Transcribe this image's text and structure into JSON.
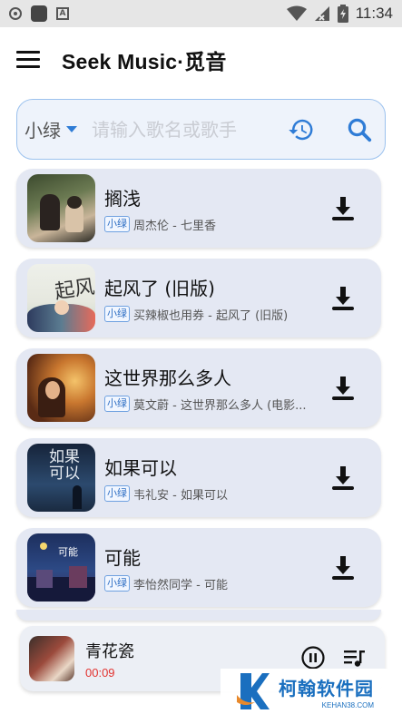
{
  "status_bar": {
    "time": "11:34"
  },
  "header": {
    "title": "Seek Music·觅音",
    "menu_icon": "menu-icon"
  },
  "search": {
    "source": "小绿",
    "placeholder": "请输入歌名或歌手",
    "history_icon": "history-icon",
    "search_icon": "search-icon"
  },
  "songs": [
    {
      "title": "搁浅",
      "source": "小绿",
      "subtitle": "周杰伦 - 七里香"
    },
    {
      "title": "起风了 (旧版)",
      "source": "小绿",
      "subtitle": "买辣椒也用券 - 起风了 (旧版)"
    },
    {
      "title": "这世界那么多人",
      "source": "小绿",
      "subtitle": "莫文蔚 - 这世界那么多人 (电影..."
    },
    {
      "title": "如果可以",
      "source": "小绿",
      "subtitle": "韦礼安 - 如果可以"
    },
    {
      "title": "可能",
      "source": "小绿",
      "subtitle": "李怡然同学 - 可能"
    }
  ],
  "player": {
    "title": "青花瓷",
    "time": "00:09",
    "pause_icon": "pause-icon",
    "playlist_icon": "playlist-icon"
  },
  "watermark": {
    "name": "柯翰软件园",
    "domain": "KEHAN38.COM"
  },
  "colors": {
    "accent": "#2f7cd6",
    "card_bg": "#e4e8f3",
    "time_red": "#e2322f"
  }
}
